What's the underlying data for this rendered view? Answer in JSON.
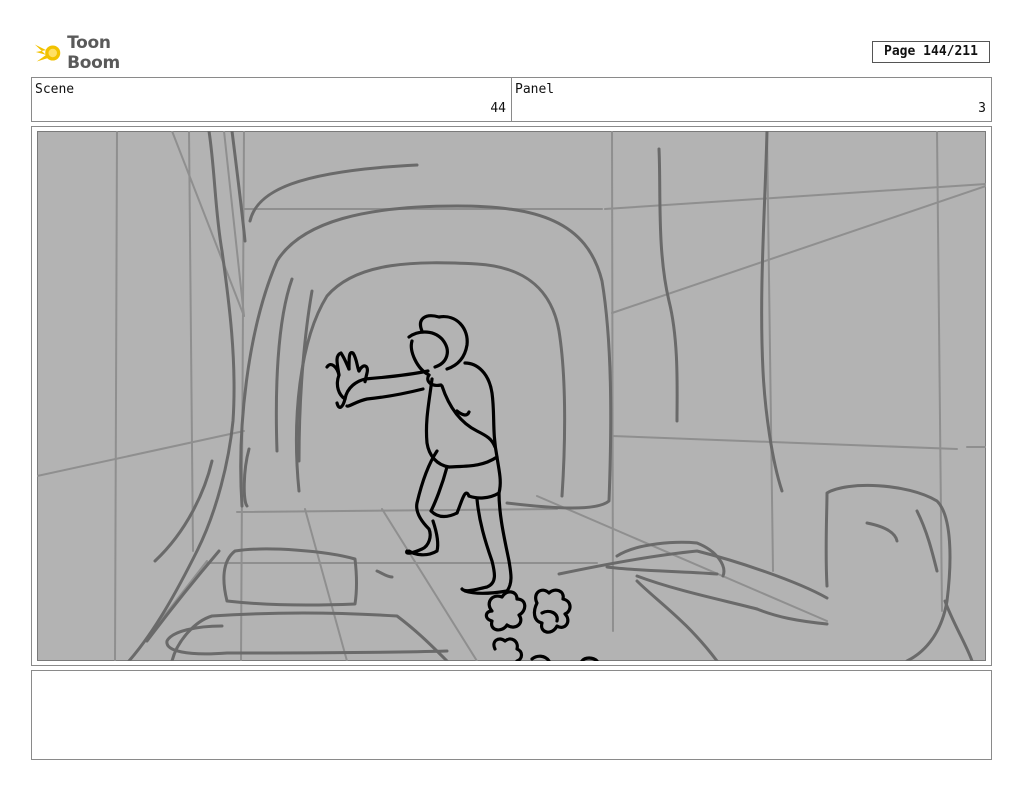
{
  "header": {
    "logo_text": "Toon Boom",
    "page_label": "Page 144/211"
  },
  "fields": {
    "scene_label": "Scene",
    "scene_value": "44",
    "panel_label": "Panel",
    "panel_value": "3"
  },
  "colors": {
    "logo_yellow": "#f2c200",
    "logo_gray": "#5a5a5a",
    "sketch_background": "#b3b3b3",
    "sketch_lines": "#6a6a6a",
    "figure_lines": "#000000"
  },
  "icons": {
    "logo": "toon-boom-comet-icon"
  },
  "notes": {
    "text": ""
  }
}
